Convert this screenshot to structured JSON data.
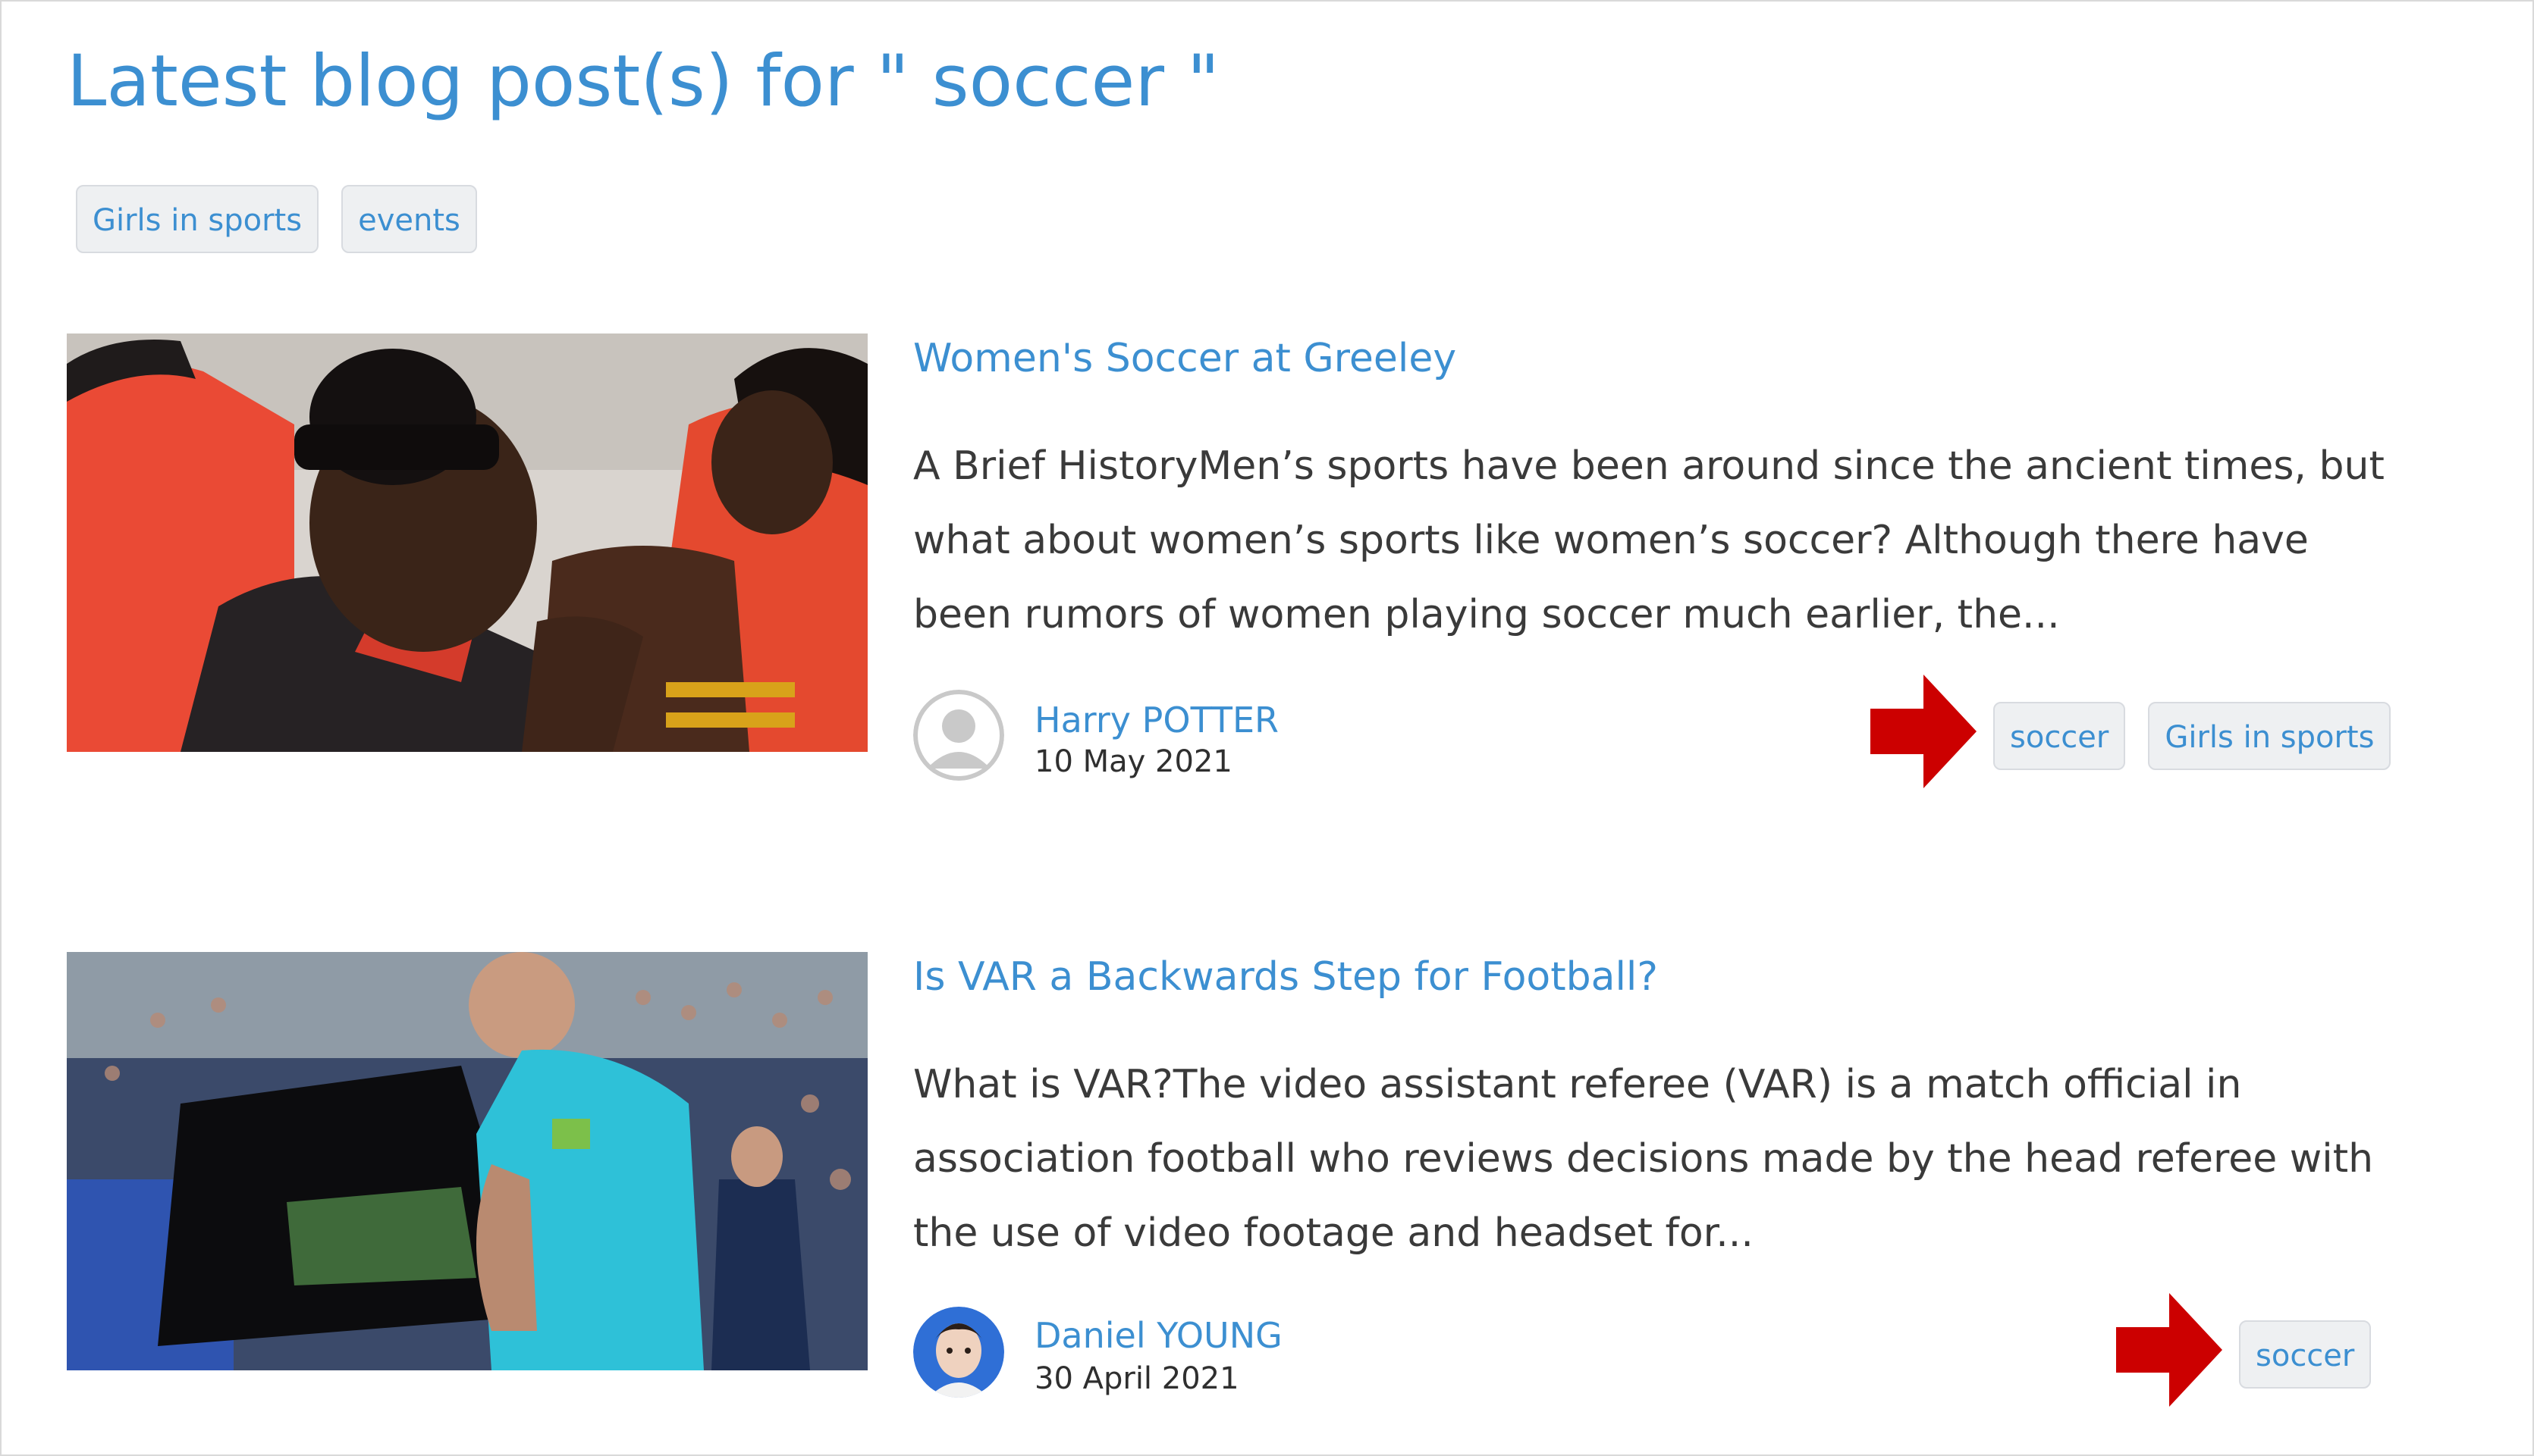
{
  "page_title": "Latest blog post(s) for \" soccer \"",
  "filter_tags": [
    "Girls in sports",
    "events"
  ],
  "colors": {
    "link_blue": "#3c8fd1",
    "tag_bg": "#eef0f2",
    "arrow_red": "#cc0000"
  },
  "posts": [
    {
      "title": "Women's Soccer at Greeley",
      "excerpt": "A Brief HistoryMen’s sports have been around since the ancient times, but what about women’s sports like women’s soccer? Although there have been rumors of women playing soccer much earlier, the...",
      "author": "Harry POTTER",
      "date": "10 May 2021",
      "avatar_icon": "default-user-icon",
      "tags": [
        "soccer",
        "Girls in sports"
      ],
      "image_icon": "soccer-players-photo"
    },
    {
      "title": "Is VAR a Backwards Step for Football?",
      "excerpt": "What is VAR?The video assistant referee (VAR) is a match official in association football who reviews decisions made by the head referee with the use of video footage and headset for...",
      "author": "Daniel YOUNG",
      "date": "30 April 2021",
      "avatar_icon": "user-photo-avatar",
      "tags": [
        "soccer"
      ],
      "image_icon": "referee-var-monitor-photo"
    }
  ]
}
